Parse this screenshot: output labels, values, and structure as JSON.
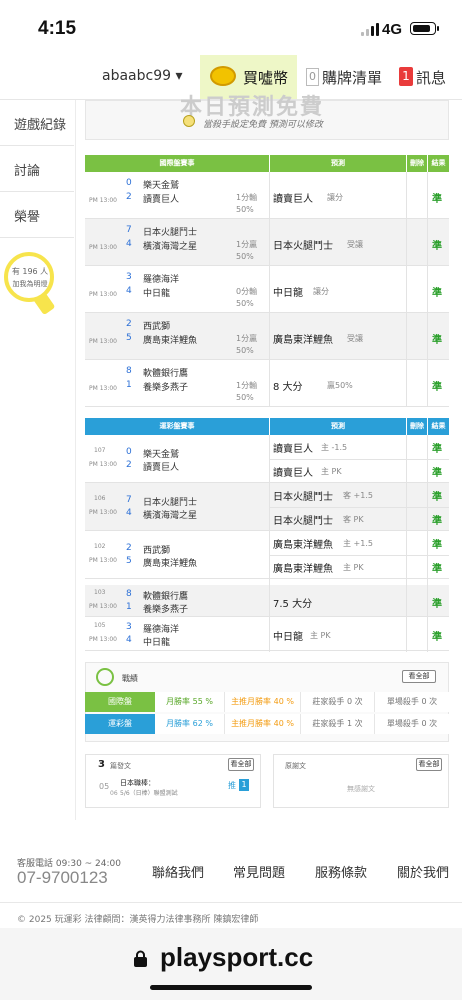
{
  "status": {
    "time": "4:15",
    "network": "4G"
  },
  "topbar": {
    "user": "abaabc99 ▾",
    "buy_coin": "買噓幣",
    "cart_count": "0",
    "cart_label": "購牌清單",
    "msg_count": "1",
    "msg_label": "訊息"
  },
  "sidebar": {
    "items": [
      {
        "label": "遊戲紀錄"
      },
      {
        "label": "討論"
      },
      {
        "label": "榮譽"
      }
    ],
    "bulb_line1": "有 196 人",
    "bulb_line2": "加我為明燈"
  },
  "promo": {
    "title": "本日預測免費",
    "subtitle": "當殺手設定免費  預測可以修改"
  },
  "intl_table": {
    "headers": [
      "國際盤賽事",
      "預測",
      "刪除",
      "結果"
    ],
    "rows": [
      {
        "time": "PM 13:00",
        "n1": "0",
        "t1": "樂天金鷲",
        "n2": "2",
        "t2": "讀賣巨人",
        "line": "1分輸",
        "pct": "50%",
        "pred": "讀賣巨人",
        "predsub": "讓分",
        "result": "準"
      },
      {
        "time": "PM 13:00",
        "n1": "7",
        "t1": "日本火腿鬥士",
        "n2": "4",
        "t2": "橫濱海灣之星",
        "line": "1分贏",
        "pct": "50%",
        "pred": "日本火腿鬥士",
        "predsub": "受讓",
        "result": "準"
      },
      {
        "time": "PM 13:00",
        "n1": "3",
        "t1": "羅德海洋",
        "n2": "4",
        "t2": "中日龍",
        "line": "0分輸",
        "pct": "50%",
        "pred": "中日龍",
        "predsub": "讓分",
        "result": "準"
      },
      {
        "time": "PM 13:00",
        "n1": "2",
        "t1": "西武獅",
        "n2": "5",
        "t2": "廣島東洋鯉魚",
        "line": "1分贏",
        "pct": "50%",
        "pred": "廣島東洋鯉魚",
        "predsub": "受讓",
        "result": "準"
      },
      {
        "time": "PM 13:00",
        "n1": "8",
        "t1": "軟體銀行鷹",
        "n2": "1",
        "t2": "養樂多燕子",
        "line": "1分輸",
        "pct": "50%",
        "pred": "8 大分",
        "predsub": "贏50%",
        "result": "準"
      }
    ]
  },
  "local_table": {
    "headers": [
      "運彩盤賽事",
      "預測",
      "刪除",
      "結果"
    ],
    "rows": [
      {
        "id": "107",
        "time": "PM 13:00",
        "n1": "0",
        "t1": "樂天金鷲",
        "n2": "2",
        "t2": "讀賣巨人",
        "p1": "讀賣巨人",
        "p1sub": "主 -1.5",
        "p2": "讀賣巨人",
        "p2sub": "主 PK",
        "r1": "準",
        "r2": "準"
      },
      {
        "id": "106",
        "time": "PM 13:00",
        "n1": "7",
        "t1": "日本火腿鬥士",
        "n2": "4",
        "t2": "橫濱海灣之星",
        "p1": "日本火腿鬥士",
        "p1sub": "客 +1.5",
        "p2": "日本火腿鬥士",
        "p2sub": "客 PK",
        "r1": "準",
        "r2": "準"
      },
      {
        "id": "102",
        "time": "PM 13:00",
        "n1": "2",
        "t1": "西武獅",
        "n2": "5",
        "t2": "廣島東洋鯉魚",
        "p1": "廣島東洋鯉魚",
        "p1sub": "主 +1.5",
        "p2": "廣島東洋鯉魚",
        "p2sub": "主 PK",
        "r1": "準",
        "r2": "準"
      },
      {
        "id": "103",
        "time": "PM 13:00",
        "n1": "8",
        "t1": "軟體銀行鷹",
        "n2": "1",
        "t2": "養樂多燕子",
        "p1": "7.5 大分",
        "p1sub": "",
        "r1": "準"
      },
      {
        "id": "105",
        "time": "PM 13:00",
        "n1": "3",
        "t1": "羅德海洋",
        "n2": "4",
        "t2": "中日龍",
        "p1": "中日龍",
        "p1sub": "主 PK",
        "r1": "準"
      }
    ]
  },
  "stats": {
    "title": "戰績",
    "view_all": "看全部",
    "intl": {
      "label": "國際盤",
      "month": "月勝率 55 %",
      "main": "主推月勝率 40 %",
      "killer": "莊家殺手 0 次",
      "single": "單場殺手 0 次"
    },
    "local": {
      "label": "運彩盤",
      "month": "月勝率 62 %",
      "main": "主推月勝率 40 %",
      "killer": "莊家殺手 1 次",
      "single": "單場殺手 0 次"
    }
  },
  "posts": {
    "count": "3",
    "title": "篇發文",
    "view_all": "看全部",
    "item": {
      "date1": "05",
      "date2": "06",
      "title": "日本職棒：",
      "sub": "5/6（日棒）聯盟測試",
      "tag": "推",
      "tag_num": "1"
    },
    "reply_title": "原謝文",
    "reply_view_all": "看全部",
    "reply_empty": "無感謝文"
  },
  "footer": {
    "phone_label": "客服電話 09:30 ~ 24:00",
    "phone": "07-9700123",
    "links": [
      "聯絡我們",
      "常見問題",
      "服務條款",
      "關於我們"
    ],
    "copyright": "© 2025 玩運彩 法律顧問：漢英得力法律事務所 陳鎮宏律師"
  },
  "browser": {
    "url": "playsport.cc"
  },
  "colors": {
    "intl_header": "#7ac143",
    "local_header": "#2a9fd8",
    "result": "#2ca02c",
    "msg_badge": "#e93b3b"
  }
}
